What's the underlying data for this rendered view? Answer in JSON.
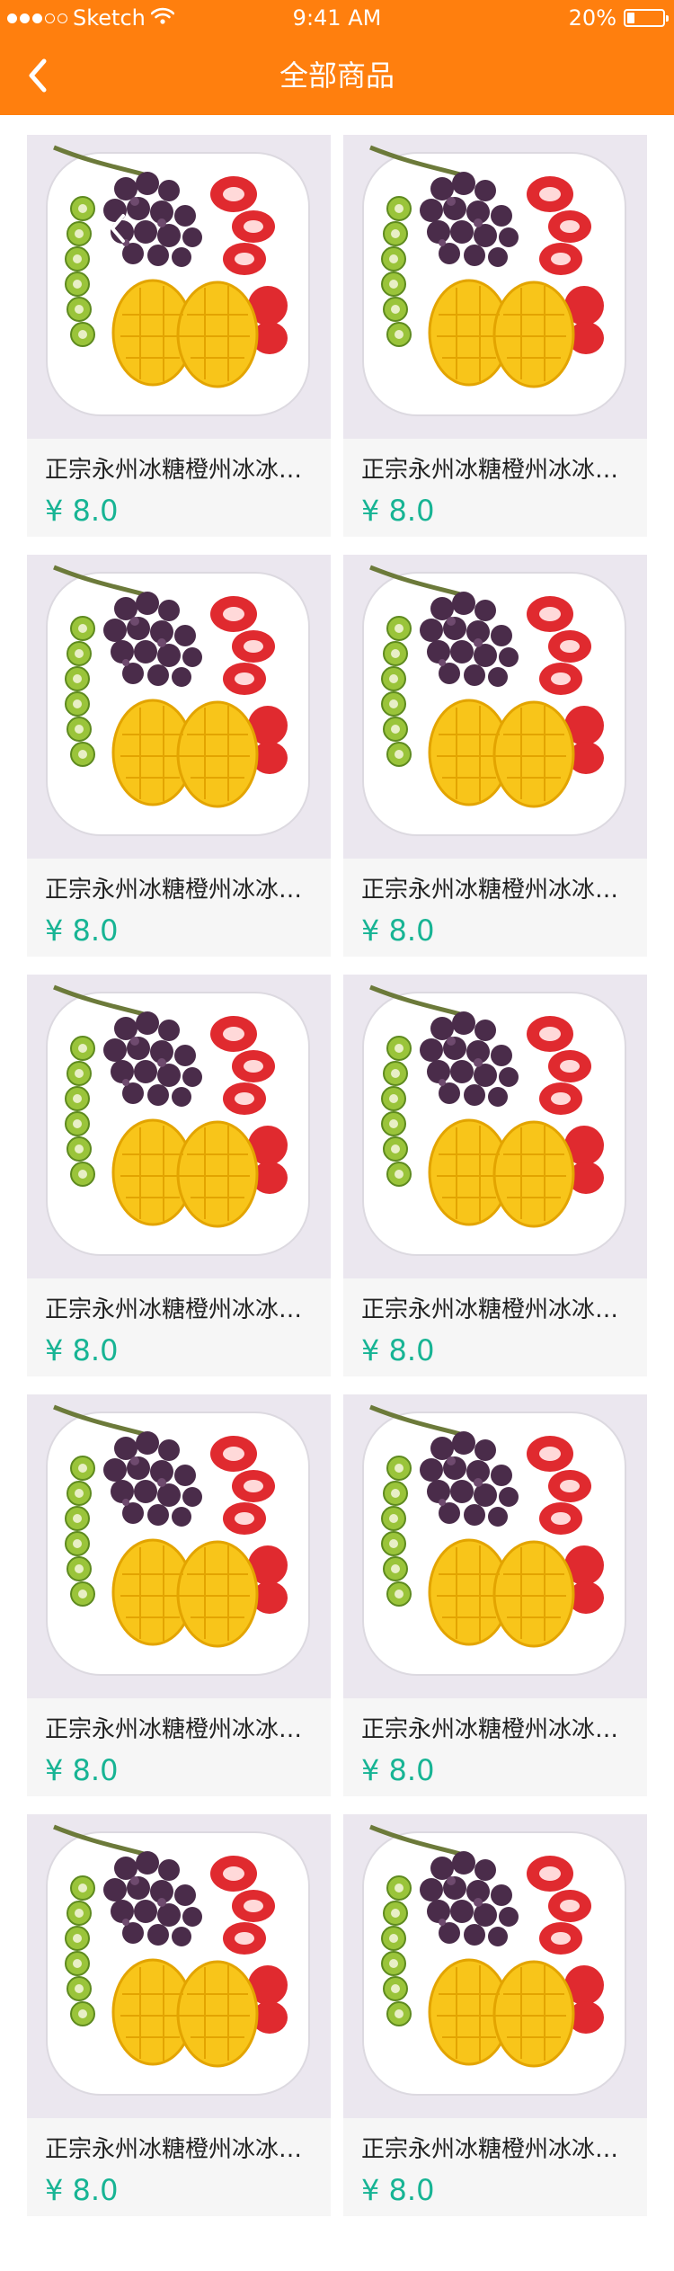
{
  "status_bar": {
    "carrier": "Sketch",
    "time": "9:41 AM",
    "battery": "20%",
    "battery_level": 0.2
  },
  "nav": {
    "title": "全部商品",
    "back_icon": "chevron-left-icon"
  },
  "products": [
    {
      "title": "正宗永州冰糖橙州冰冰…",
      "price": "¥ 8.0"
    },
    {
      "title": "正宗永州冰糖橙州冰冰…",
      "price": "¥ 8.0"
    },
    {
      "title": "正宗永州冰糖橙州冰冰…",
      "price": "¥ 8.0"
    },
    {
      "title": "正宗永州冰糖橙州冰冰…",
      "price": "¥ 8.0"
    },
    {
      "title": "正宗永州冰糖橙州冰冰…",
      "price": "¥ 8.0"
    },
    {
      "title": "正宗永州冰糖橙州冰冰…",
      "price": "¥ 8.0"
    },
    {
      "title": "正宗永州冰糖橙州冰冰…",
      "price": "¥ 8.0"
    },
    {
      "title": "正宗永州冰糖橙州冰冰…",
      "price": "¥ 8.0"
    },
    {
      "title": "正宗永州冰糖橙州冰冰…",
      "price": "¥ 8.0"
    },
    {
      "title": "正宗永州冰糖橙州冰冰…",
      "price": "¥ 8.0"
    }
  ],
  "colors": {
    "header": "#ff7f0e",
    "price": "#17b494",
    "card_bg": "#f6f6f6"
  }
}
